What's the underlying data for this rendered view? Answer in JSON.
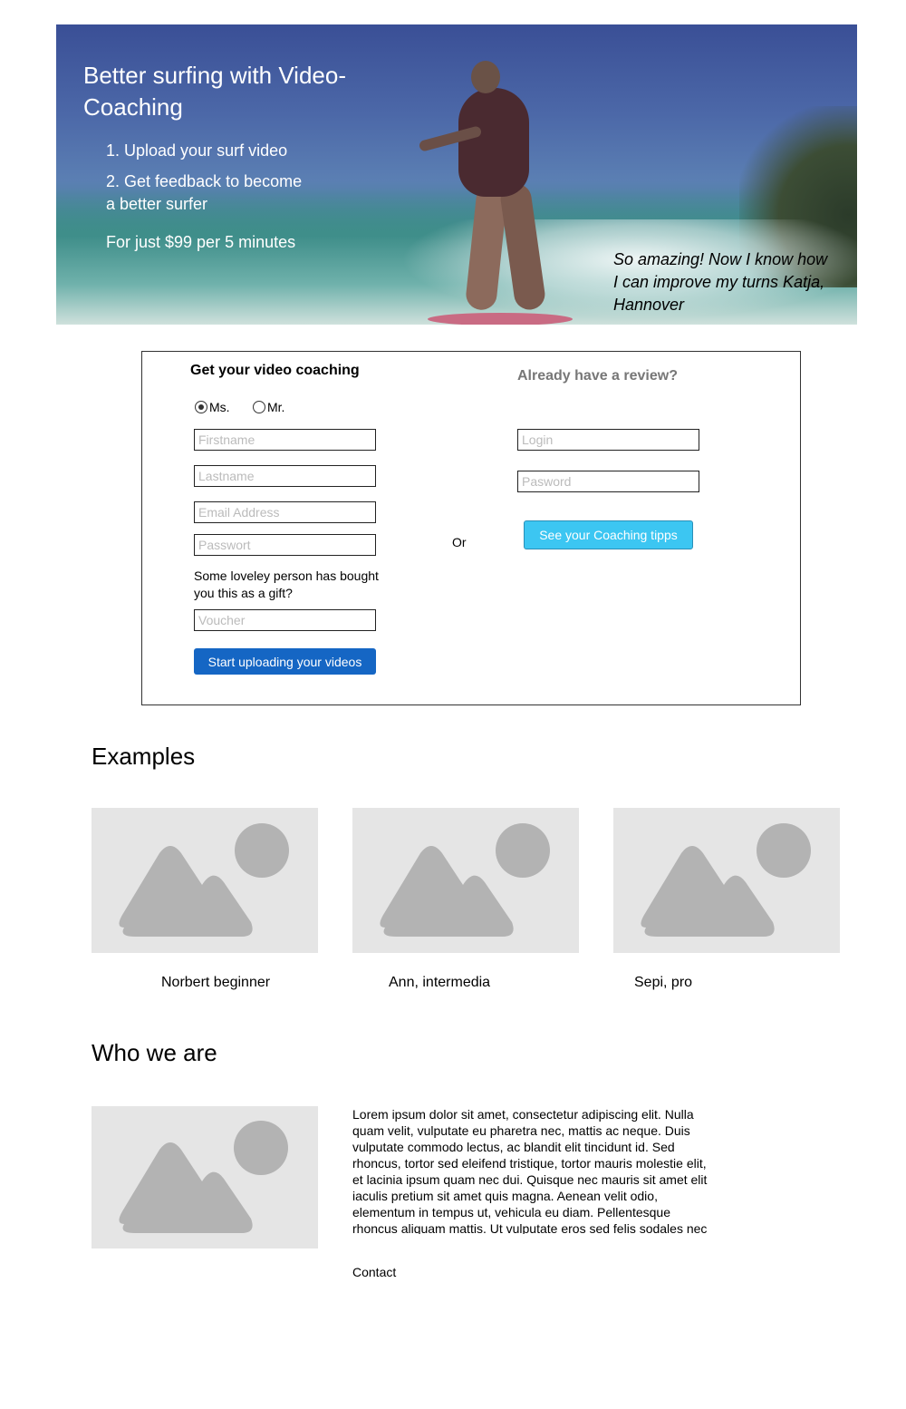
{
  "hero": {
    "title": "Better surfing with Video-Coaching",
    "step1": "1. Upload your surf video",
    "step2": "2. Get feedback to become a better surfer",
    "price": "For just $99 per 5 minutes",
    "quote": "So amazing! Now I know how I can improve my turns Katja, Hannover",
    "image": "surfer-photo"
  },
  "signup": {
    "title": "Get your video coaching",
    "radio_ms": "Ms.",
    "radio_mr": "Mr.",
    "selected": "Ms.",
    "firstname_placeholder": "Firstname",
    "lastname_placeholder": "Lastname",
    "email_placeholder": "Email Address",
    "password_placeholder": "Passwort",
    "gift_text": "Some loveley person has bought you this as a gift?",
    "voucher_placeholder": "Voucher",
    "submit_label": "Start uploading your videos"
  },
  "separator": "Or",
  "login": {
    "title": "Already have a review?",
    "login_placeholder": "Login",
    "password_placeholder": "Pasword",
    "button_label": "See your Coaching tipps"
  },
  "examples": {
    "title": "Examples",
    "items": [
      {
        "caption": "Norbert beginner",
        "icon": "image-placeholder-icon"
      },
      {
        "caption": "Ann, intermedia",
        "icon": "image-placeholder-icon"
      },
      {
        "caption": "Sepi, pro",
        "icon": "image-placeholder-icon"
      }
    ]
  },
  "about": {
    "title": "Who we are",
    "text": "Lorem ipsum dolor sit amet, consectetur adipiscing elit. Nulla quam velit, vulputate eu pharetra nec, mattis ac neque. Duis vulputate commodo lectus, ac blandit elit tincidunt id. Sed rhoncus, tortor sed eleifend tristique, tortor mauris molestie elit, et lacinia ipsum quam nec dui. Quisque nec mauris sit amet elit iaculis pretium sit amet quis magna. Aenean velit odio, elementum in tempus ut, vehicula eu diam. Pellentesque rhoncus aliquam mattis. Ut vulputate eros sed felis sodales nec",
    "contact": "Contact",
    "image_icon": "image-placeholder-icon"
  },
  "colors": {
    "primary_button": "#1566c4",
    "secondary_button": "#3cc6f2",
    "placeholder_bg": "#e5e5e5",
    "placeholder_shape": "#b3b3b3"
  }
}
